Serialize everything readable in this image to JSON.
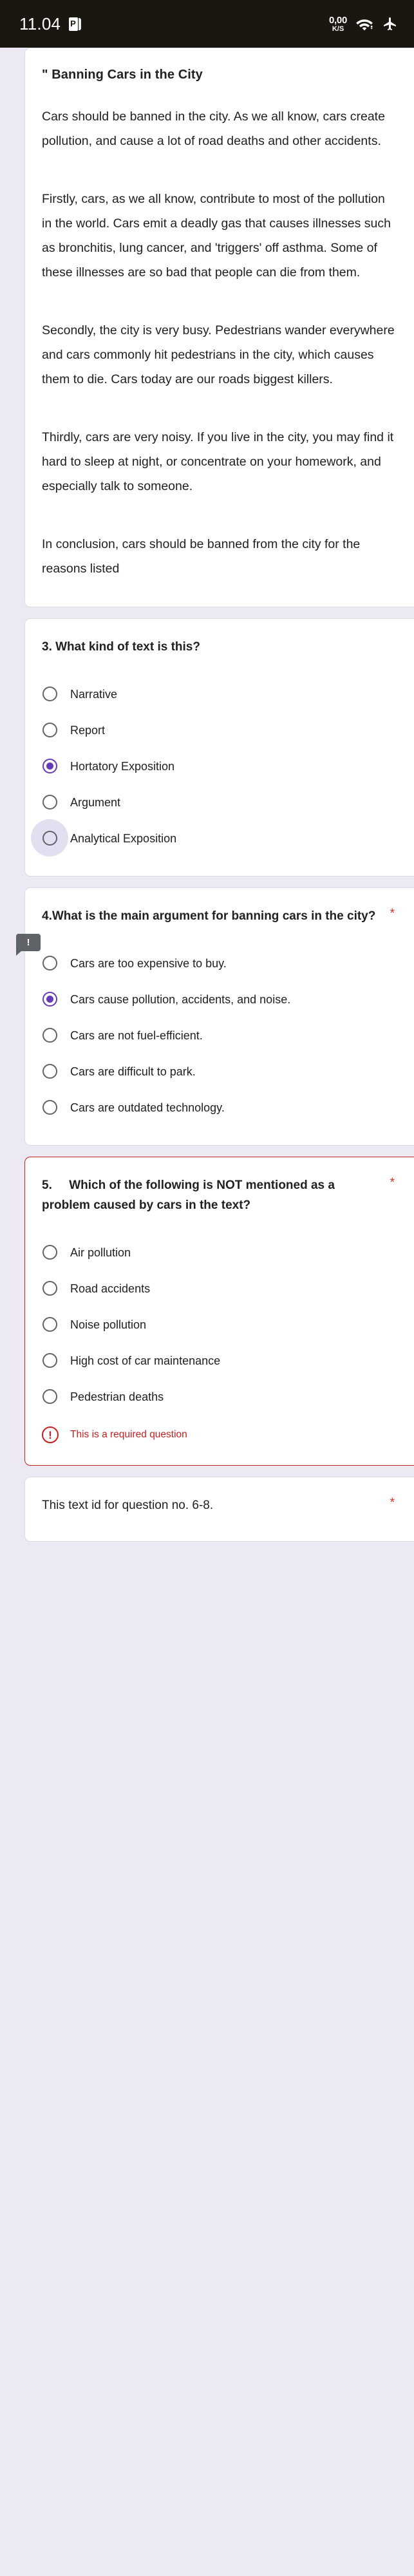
{
  "statusbar": {
    "time": "11.04",
    "app_icon": "powerpoint-icon",
    "app_icon_letter": "P",
    "netspeed_value": "0,00",
    "netspeed_unit": "K/S",
    "wifi_icon": "wifi-icon",
    "airplane_icon": "airplane-mode-icon"
  },
  "passage": {
    "title": "\" Banning Cars in the City",
    "paragraphs": [
      "Cars should be banned in the city. As we all know, cars create pollution, and cause a lot of road deaths and other accidents.",
      "Firstly, cars, as we all know, contribute to most of the pollution in the world. Cars emit a deadly gas that causes illnesses such as bronchitis, lung cancer, and 'triggers' off asthma. Some of these illnesses are so bad that people can die from them.",
      "Secondly, the city is very busy. Pedestrians wander everywhere and cars commonly hit pedestrians in the city, which causes them to die. Cars today are our roads biggest killers.",
      "Thirdly, cars are very noisy. If you live in the city, you may find it hard to sleep at night, or concentrate on your homework, and especially talk to someone.",
      "In conclusion, cars should be banned from the city for the reasons listed"
    ],
    "comment_marker": "!"
  },
  "questions": [
    {
      "title": "3. What kind of text is this?",
      "required_mark": "",
      "error": null,
      "options": [
        {
          "label": "Narrative",
          "checked": false,
          "hovered": false
        },
        {
          "label": "Report",
          "checked": false,
          "hovered": false
        },
        {
          "label": "Hortatory Exposition",
          "checked": true,
          "hovered": false
        },
        {
          "label": "Argument",
          "checked": false,
          "hovered": false
        },
        {
          "label": "Analytical Exposition",
          "checked": false,
          "hovered": true
        }
      ]
    },
    {
      "title": "4.What is the main argument for banning cars in the city?",
      "required_mark": "*",
      "error": null,
      "options": [
        {
          "label": "Cars are too expensive to buy.",
          "checked": false,
          "hovered": false
        },
        {
          "label": "Cars cause pollution, accidents, and noise.",
          "checked": true,
          "hovered": false
        },
        {
          "label": "Cars are not fuel-efficient.",
          "checked": false,
          "hovered": false
        },
        {
          "label": "Cars are difficult to park.",
          "checked": false,
          "hovered": false
        },
        {
          "label": "Cars are outdated technology.",
          "checked": false,
          "hovered": false
        }
      ]
    },
    {
      "title": "5.\tWhich of the following is NOT mentioned as a problem caused by cars in the text?",
      "required_mark": "*",
      "error": "This is a required question",
      "error_icon": "!",
      "options": [
        {
          "label": "Air pollution",
          "checked": false,
          "hovered": false
        },
        {
          "label": "Road accidents",
          "checked": false,
          "hovered": false
        },
        {
          "label": "Noise pollution",
          "checked": false,
          "hovered": false
        },
        {
          "label": "High cost of car maintenance",
          "checked": false,
          "hovered": false
        },
        {
          "label": "Pedestrian deaths",
          "checked": false,
          "hovered": false
        }
      ]
    },
    {
      "title": "This text id for question no. 6-8.",
      "required_mark": "*",
      "error": null,
      "options": []
    }
  ],
  "colors": {
    "accent": "#673ab7",
    "error": "#c5221f",
    "page_bg": "#ece9f4",
    "card_bg": "#ffffff",
    "statusbar_bg": "#1a1710",
    "text": "#202124"
  }
}
